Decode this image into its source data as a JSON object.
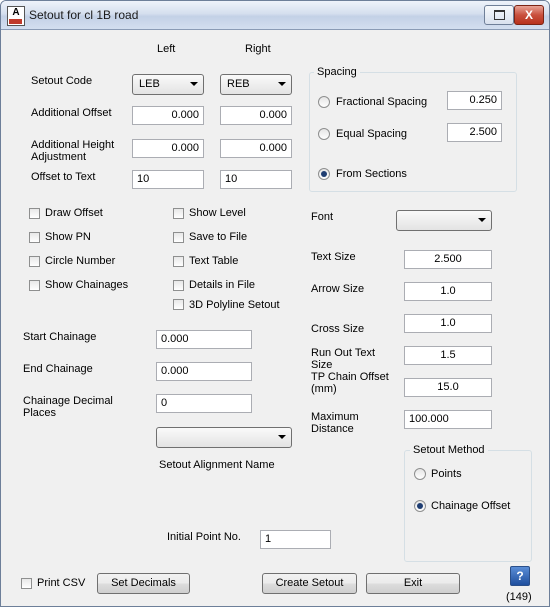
{
  "window": {
    "title": "Setout for cl 1B road",
    "close_label": "X"
  },
  "columns": {
    "left": "Left",
    "right": "Right"
  },
  "setout_code": {
    "label": "Setout Code",
    "left": "LEB",
    "right": "REB"
  },
  "additional_offset": {
    "label": "Additional Offset",
    "left": "0.000",
    "right": "0.000"
  },
  "additional_height": {
    "label_line1": "Additional Height",
    "label_line2": "Adjustment",
    "left": "0.000",
    "right": "0.000"
  },
  "offset_to_text": {
    "label": "Offset to Text",
    "left": "10",
    "right": "10"
  },
  "spacing": {
    "title": "Spacing",
    "fractional": {
      "label": "Fractional Spacing",
      "value": "0.250",
      "selected": false
    },
    "equal": {
      "label": "Equal Spacing",
      "value": "2.500",
      "selected": false
    },
    "sections": {
      "label": "From Sections",
      "selected": true
    }
  },
  "checks_left": [
    "Draw Offset",
    "Show PN",
    "Circle Number",
    "Show Chainages"
  ],
  "checks_right": [
    "Show Level",
    "Save to File",
    "Text Table",
    "Details in File",
    "3D Polyline Setout"
  ],
  "font": {
    "label": "Font",
    "value": ""
  },
  "text_size": {
    "label": "Text Size",
    "value": "2.500"
  },
  "arrow_size": {
    "label": "Arrow Size",
    "value": "1.0"
  },
  "cross_size": {
    "label": "Cross Size",
    "value": "1.0"
  },
  "run_out": {
    "label_line1": "Run Out Text",
    "label_line2": "Size",
    "value": "1.5"
  },
  "tp_chain": {
    "label_line1": "TP Chain Offset",
    "label_line2": "(mm)",
    "value": "15.0"
  },
  "max_distance": {
    "label_line1": "Maximum",
    "label_line2": "Distance",
    "value": "100.000"
  },
  "start_chainage": {
    "label": "Start Chainage",
    "value": "0.000"
  },
  "end_chainage": {
    "label": "End Chainage",
    "value": "0.000"
  },
  "chainage_decimal": {
    "label_line1": "Chainage Decimal",
    "label_line2": "Places",
    "value": "0"
  },
  "alignment": {
    "value": "",
    "label": "Setout Alignment Name"
  },
  "setout_method": {
    "title": "Setout Method",
    "points": {
      "label": "Points",
      "selected": false
    },
    "chainage_offset": {
      "label": "Chainage Offset",
      "selected": true
    }
  },
  "initial_point": {
    "label": "Initial Point No.",
    "value": "1"
  },
  "footer": {
    "print_csv": "Print CSV",
    "set_decimals": "Set Decimals",
    "create_setout": "Create Setout",
    "exit": "Exit",
    "help": "?",
    "count": "(149)"
  }
}
